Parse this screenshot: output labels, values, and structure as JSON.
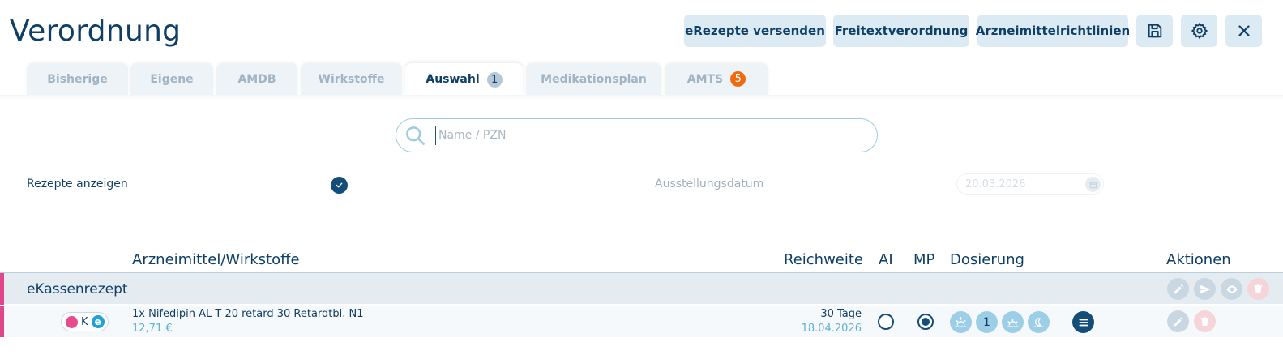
{
  "header": {
    "title": "Verordnung",
    "buttons": {
      "send_erezepte": "eRezepte versenden",
      "freitext": "Freitextverordnung",
      "richtlinien": "Arzneimittelrichtlinien"
    },
    "icons": [
      "save-icon",
      "gear-icon",
      "close-icon"
    ]
  },
  "tabs": [
    {
      "label": "Bisherige"
    },
    {
      "label": "Eigene"
    },
    {
      "label": "AMDB"
    },
    {
      "label": "Wirkstoffe"
    },
    {
      "label": "Auswahl",
      "badge": "1",
      "active": true
    },
    {
      "label": "Medikationsplan"
    },
    {
      "label": "AMTS",
      "badge": "5"
    }
  ],
  "search": {
    "placeholder": "Name / PZN",
    "value": ""
  },
  "filters": {
    "show_prescriptions_label": "Rezepte anzeigen",
    "show_prescriptions_checked": true,
    "issue_date_label": "Ausstellungsdatum",
    "issue_date_value": "20.03.2026"
  },
  "columns": {
    "drug": "Arzneimittel/Wirkstoffe",
    "reach": "Reichweite",
    "ai": "AI",
    "mp": "MP",
    "dosage": "Dosierung",
    "actions": "Aktionen"
  },
  "groups": [
    {
      "title": "eKassenrezept",
      "accent_color": "#e0478a",
      "items": [
        {
          "badge_letter": "K",
          "badge_e": "e",
          "name": "1x Nifedipin AL T 20 retard 30 Retardtbl. N1",
          "price": "12,71 €",
          "reach_days": "30 Tage",
          "reach_date": "18.04.2026",
          "ai_selected": false,
          "mp_selected": true,
          "dosage": [
            "",
            "1",
            "",
            ""
          ]
        }
      ]
    }
  ],
  "colors": {
    "primary": "#0f3f66",
    "button_bg": "#dbeaf3",
    "accent_orange": "#f06a0f",
    "light_blue": "#5eb2d6"
  }
}
